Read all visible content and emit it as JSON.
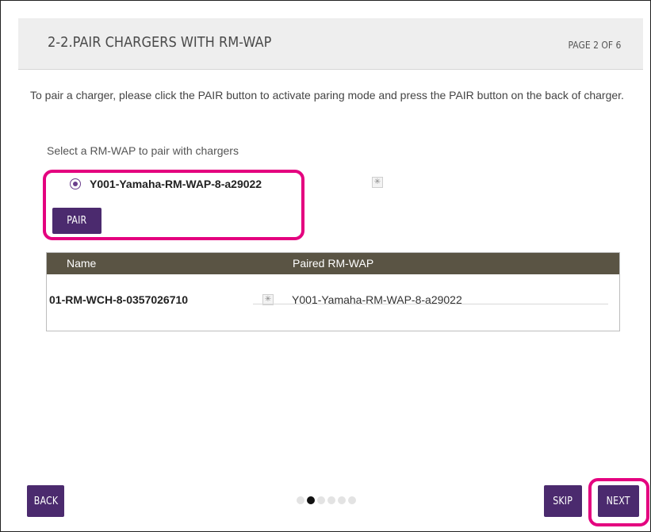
{
  "header": {
    "title": "2-2.PAIR CHARGERS WITH RM-WAP",
    "page_indicator": "PAGE 2 OF 6"
  },
  "instructions": "To pair a charger, please click the PAIR button to activate paring mode and press the PAIR button on the back of charger.",
  "selection": {
    "label": "Select a RM-WAP to pair with chargers",
    "options": [
      {
        "label": "Y001-Yamaha-RM-WAP-8-a29022",
        "selected": true
      }
    ],
    "pair_button": "PAIR"
  },
  "table": {
    "columns": [
      "Name",
      "Paired RM-WAP"
    ],
    "rows": [
      {
        "name": "01-RM-WCH-8-0357026710",
        "paired": "Y001-Yamaha-RM-WAP-8-a29022"
      }
    ]
  },
  "footer": {
    "back_label": "BACK",
    "skip_label": "SKIP",
    "next_label": "NEXT",
    "pagination": {
      "total": 6,
      "current": 2
    }
  },
  "colors": {
    "primary": "#4b2a6e",
    "highlight": "#e4007f",
    "table_header": "#5a5444",
    "header_bg": "#eeeeee"
  },
  "icons": {
    "locate": "locate-icon"
  }
}
